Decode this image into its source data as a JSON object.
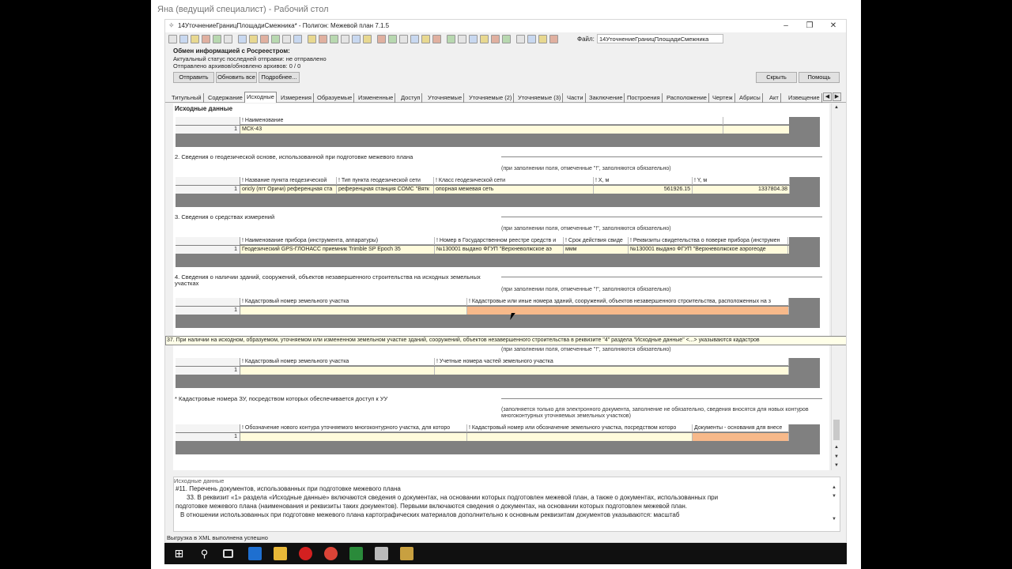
{
  "rdp_title": "Яна (ведущий специалист) - Рабочий стол",
  "app": {
    "title": "14УточнениеГраницПлощадиСмежника* - Полигон: Межевой план 7.1.5",
    "file_label": "Файл:",
    "file_name": "14УточнениеГраницПлощадиСмежника"
  },
  "rosreestr": {
    "header": "Обмен информацией с Росреестром:",
    "status_line": "Актуальный статус последней отправки: не отправлено",
    "archives_line": "Отправлено архивов/обновлено архивов: 0 / 0",
    "btn_send": "Отправить",
    "btn_refresh_all": "Обновить все",
    "btn_details": "Подробнее...",
    "btn_hide": "Скрыть",
    "btn_help": "Помощь"
  },
  "tabs": [
    "Титульный",
    "Содержание",
    "Исходные",
    "Измерения",
    "Образуемые",
    "Измененные",
    "Доступ",
    "Уточняемые",
    "Уточняемые (2)",
    "Уточняемые (3)",
    "Части",
    "Заключение",
    "Построения",
    "Расположение",
    "Чертеж",
    "Абрисы",
    "Акт",
    "Извещение"
  ],
  "content": {
    "section_title": "Исходные данные",
    "hint_required": "(при заполнении поля, отмеченные \"!\", заполняются обязательно)",
    "grid1": {
      "headers": [
        "! Наименование"
      ],
      "rows": [
        {
          "n": "1",
          "cells": [
            "МСК-43"
          ]
        }
      ]
    },
    "s2_label": "2. Сведения о геодезической основе, использованной при подготовке межевого плана",
    "grid2": {
      "headers": [
        "! Название пункта геодезической",
        "! Тип пункта геодезической сети",
        "! Класс геодезической сети",
        "! X, м",
        "! Y, м"
      ],
      "rows": [
        {
          "n": "1",
          "cells": [
            "oricly (пгт Оричи) референцная ста",
            "референцная станция СОМС \"Вятк",
            "опорная межевая сеть",
            "561926.15",
            "1337804.38"
          ]
        }
      ]
    },
    "s3_label": "3. Сведения о средствах измерений",
    "grid3": {
      "headers": [
        "! Наименование прибора (инструмента, аппаратуры)",
        "! Номер в Государственном реестре средств и",
        "! Срок действия свиде",
        "! Реквизиты свидетельства о поверке прибора (инструмен"
      ],
      "rows": [
        {
          "n": "1",
          "cells": [
            "Геодезический GPS-ГЛОНАСС приемник Trimble SP Epoch 35",
            "№130001 выдано ФГУП \"Верхневолжское аэ",
            "ммм",
            "№130001 выдано ФГУП \"Верхневолжское аэрогеоде"
          ]
        }
      ]
    },
    "s4_label": "4. Сведения о наличии зданий, сооружений, объектов незавершенного строительства на исходных земельных участках",
    "grid4": {
      "headers": [
        "! Кадастровый номер земельного участка",
        "! Кадастровые или иные номера зданий, сооружений, объектов незавершенного строительства, расположенных на з"
      ],
      "rows": [
        {
          "n": "1",
          "cells": [
            "",
            ""
          ]
        }
      ]
    },
    "tooltip": "37. При наличии на исходном, образуемом, уточняемом или измененном земельном участке зданий, сооружений, объектов незавершенного строительства в реквизите \"4\" раздела \"Исходные данные\" <...> указываются кадастров",
    "grid5": {
      "headers": [
        "! Кадастровый номер земельного участка",
        "! Учетные номера частей земельного участка"
      ],
      "rows": [
        {
          "n": "1",
          "cells": [
            "",
            ""
          ]
        }
      ]
    },
    "s6_label": "* Кадастровые номера ЗУ, посредством которых обеспечивается доступ к УУ",
    "hint_optional": "(заполняется только для электронного документа, заполнение не обязательно, сведения вносятся для новых контуров многоконтурных уточняемых земельных участков)",
    "grid6": {
      "headers": [
        "! Обозначение нового контура уточняемого многоконтурного участка, для которо",
        "! Кадастровый номер или обозначение земельного участка, посредством которо",
        "Документы - основания для внесе"
      ],
      "rows": [
        {
          "n": "1",
          "cells": [
            "",
            "",
            ""
          ]
        }
      ]
    }
  },
  "help": {
    "title": "Исходные данные",
    "line1": "#11. Перечень документов, использованных при подготовке межевого плана",
    "line2": "33. В реквизит «1» раздела «Исходные данные» включаются сведения о документах, на основании которых подготовлен межевой план, а также о документах, использованных при",
    "line3": "подготовке межевого плана (наименования и реквизиты таких документов). Первыми включаются сведения о документах, на основании которых подготовлен межевой план.",
    "line4": "В отношении использованных при подготовке межевого плана картографических материалов дополнительно к основным реквизитам документов указываются: масштаб"
  },
  "status": "Выгрузка в XML выполнена успешно",
  "colors": {
    "grid_bg": "#808080",
    "row_yellow": "#fffbdc",
    "cell_orange": "#f7b98a"
  }
}
